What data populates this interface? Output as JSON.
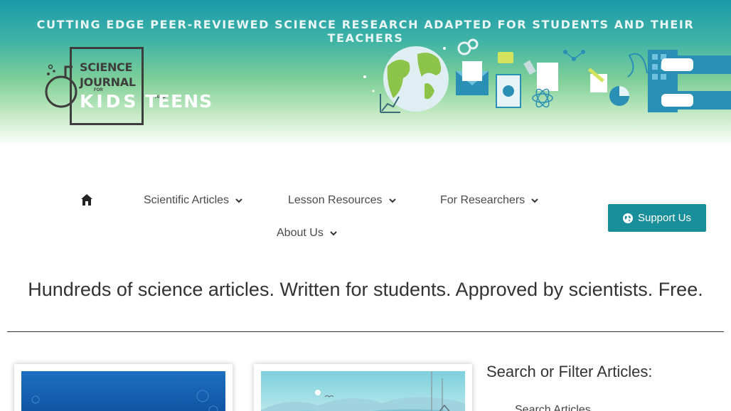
{
  "banner": {
    "tagline": "CUTTING EDGE PEER-REVIEWED SCIENCE RESEARCH ADAPTED FOR STUDENTS AND THEIR TEACHERS",
    "logo": {
      "line1": "SCIENCE",
      "line2": "JOURNAL",
      "for": "FOR",
      "kids": "KIDS",
      "and": "AND",
      "teens": "TEENS"
    }
  },
  "nav": {
    "home_icon": "home-icon",
    "items": [
      {
        "label": "Scientific Articles"
      },
      {
        "label": "Lesson Resources"
      },
      {
        "label": "For Researchers"
      },
      {
        "label": "About Us"
      }
    ],
    "support_label": "Support Us"
  },
  "main": {
    "headline": "Hundreds of science articles. Written for students. Approved by scientists. Free.",
    "filter_title": "Search or Filter Articles:",
    "filter_subtitle": "Search Articles"
  },
  "colors": {
    "banner_top": "#1b9aa8",
    "banner_mid": "#7fcf98",
    "accent": "#1a8f9c"
  }
}
